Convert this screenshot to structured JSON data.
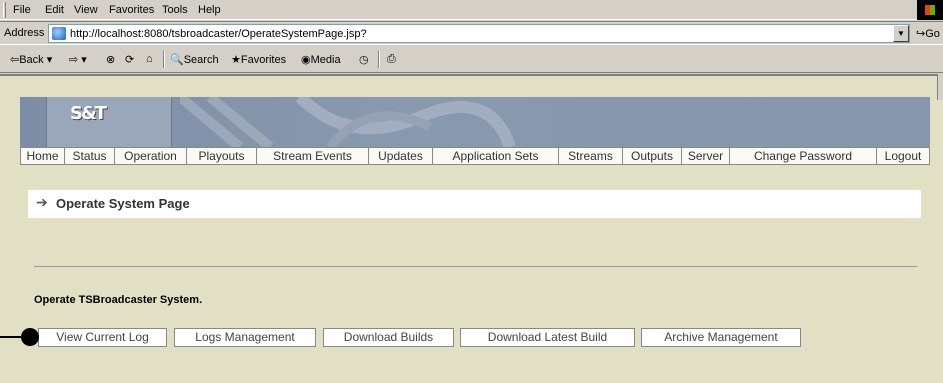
{
  "menu": {
    "items": [
      "File",
      "Edit",
      "View",
      "Favorites",
      "Tools",
      "Help"
    ]
  },
  "address": {
    "label": "Address",
    "url": "http://localhost:8080/tsbroadcaster/OperateSystemPage.jsp?",
    "go_label": "Go"
  },
  "toolbar": {
    "back": "Back",
    "search": "Search",
    "favorites": "Favorites",
    "media": "Media"
  },
  "page": {
    "logo": "S&T",
    "nav": [
      "Home",
      "Status",
      "Operation",
      "Playouts",
      "Stream Events",
      "Updates",
      "Application Sets",
      "Streams",
      "Outputs",
      "Server",
      "Change Password",
      "Logout"
    ],
    "title": "Operate System Page",
    "description": "Operate TSBroadcaster System.",
    "buttons": [
      "View Current Log",
      "Logs Management",
      "Download Builds",
      "Download Latest Build",
      "Archive Management"
    ]
  },
  "colors": {
    "page_bg": "#e2e0c4",
    "banner": "#8697ad",
    "chrome": "#d4d0c8"
  }
}
